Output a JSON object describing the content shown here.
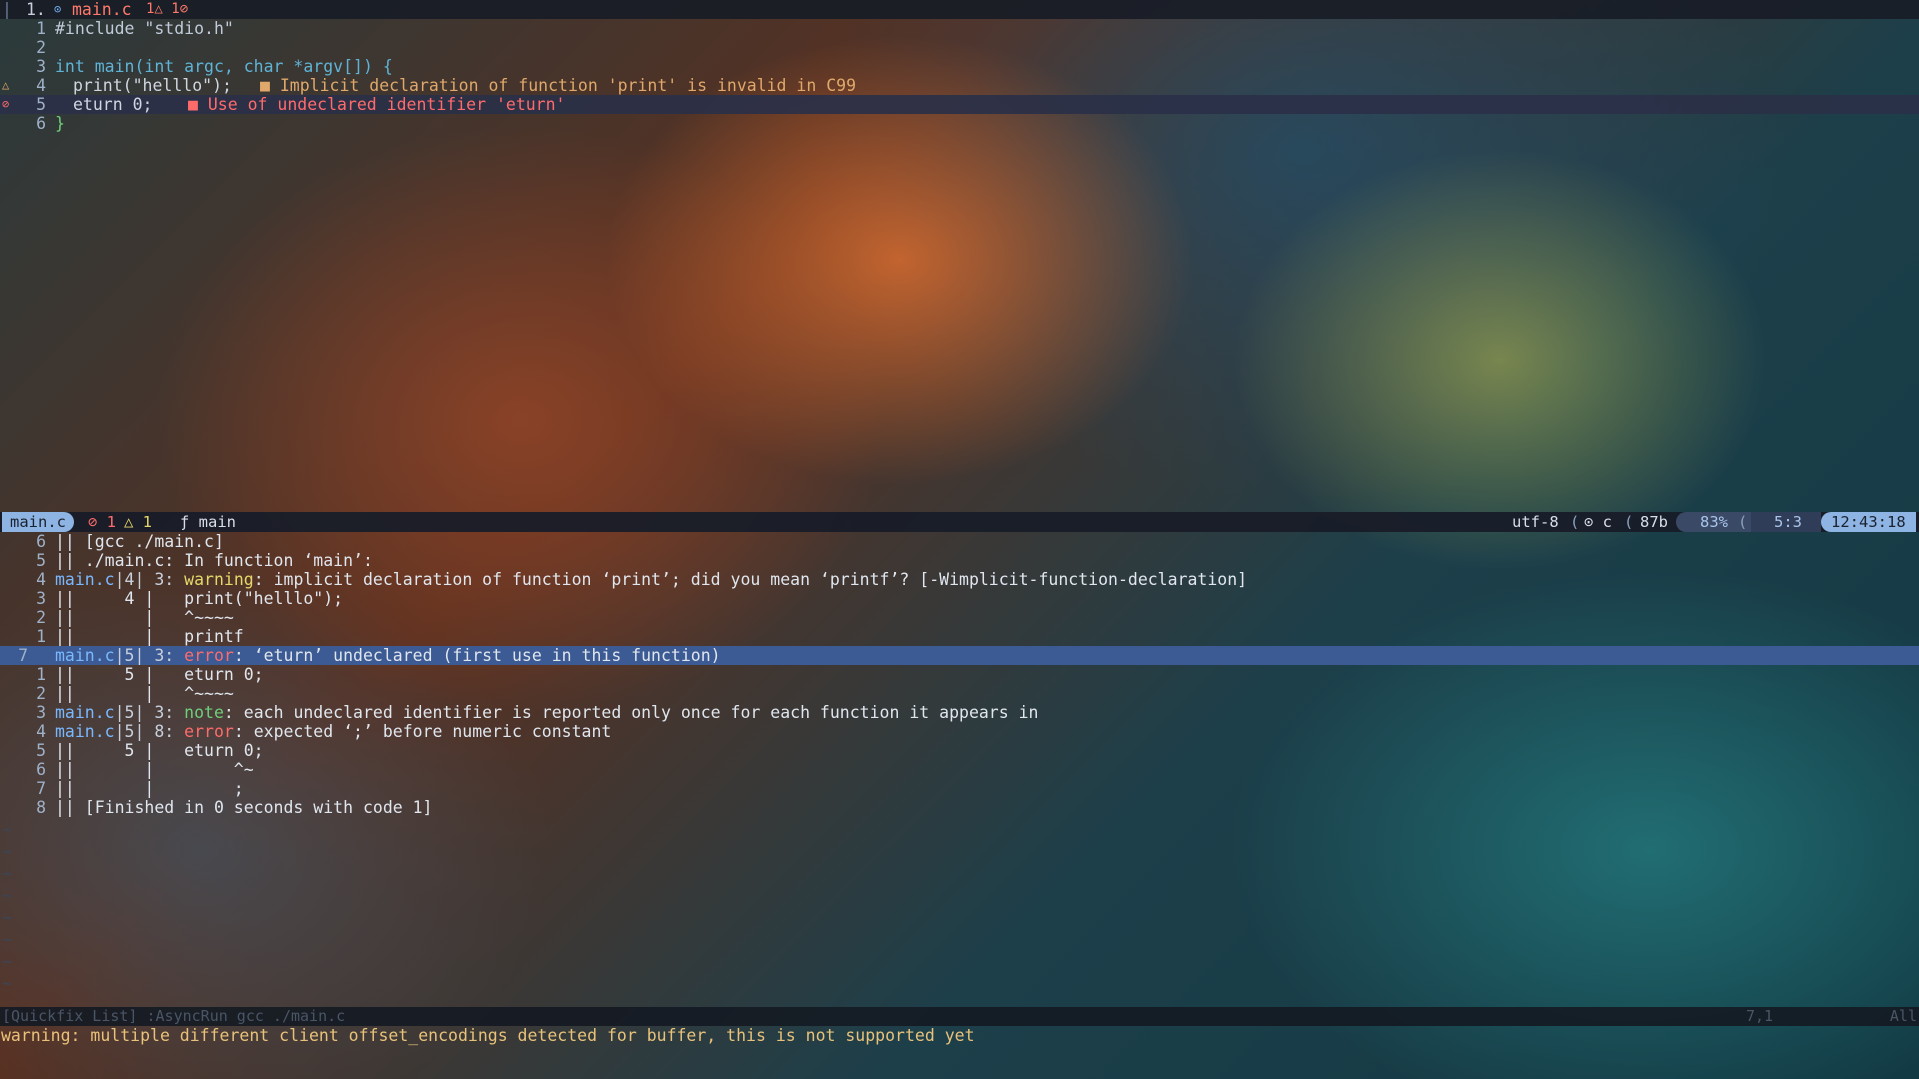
{
  "tabline": {
    "tab_number": "1.",
    "tab_icon": "c-file-icon",
    "tab_file": "main.c",
    "tab_diag": "1△ 1⊘"
  },
  "editor": {
    "lines": [
      {
        "num": "1",
        "text": "#include \"stdio.h\""
      },
      {
        "num": "2",
        "text": ""
      },
      {
        "num": "3",
        "text": "int main(int argc, char *argv[]) {"
      },
      {
        "num": "4",
        "text": "print(\"helllo\");",
        "sign": "△",
        "diag": "■ Implicit declaration of function 'print' is invalid in C99"
      },
      {
        "num": "5",
        "text": "eturn 0;",
        "sign": "⊘",
        "diag": "■ Use of undeclared identifier 'eturn'"
      },
      {
        "num": "6",
        "text": "}"
      }
    ]
  },
  "statusbar": {
    "mode_file": "main.c",
    "errors": "⊘ 1",
    "warnings": "△ 1",
    "func": "ƒ main",
    "encoding": "utf-8",
    "filetype": "⊙ c",
    "size": "87b",
    "percent": "83%",
    "position": "5:3",
    "clock": "12:43:18"
  },
  "quickfix": {
    "lines": [
      {
        "num": "6",
        "text": "|| [gcc ./main.c]"
      },
      {
        "num": "5",
        "text": "|| ./main.c: In function ‘main’:"
      },
      {
        "num": "4",
        "file": "main.c",
        "loc": "|4| 3:",
        "kind": "warning",
        "msg": ": implicit declaration of function ‘print’; did you mean ‘printf’? [-Wimplicit-function-declaration]"
      },
      {
        "num": "3",
        "text": "||     4 |   print(\"helllo\");"
      },
      {
        "num": "2",
        "text": "||       |   ^~~~~"
      },
      {
        "num": "1",
        "text": "||       |   printf"
      },
      {
        "num": "7",
        "file": "main.c",
        "loc": "|5| 3:",
        "kind": "error",
        "msg": ": ‘eturn’ undeclared (first use in this function)"
      },
      {
        "num": "1",
        "text": "||     5 |   eturn 0;"
      },
      {
        "num": "2",
        "text": "||       |   ^~~~~"
      },
      {
        "num": "3",
        "file": "main.c",
        "loc": "|5| 3:",
        "kind": "note",
        "msg": ": each undeclared identifier is reported only once for each function it appears in"
      },
      {
        "num": "4",
        "file": "main.c",
        "loc": "|5| 8:",
        "kind": "error",
        "msg": ": expected ‘;’ before numeric constant"
      },
      {
        "num": "5",
        "text": "||     5 |   eturn 0;"
      },
      {
        "num": "6",
        "text": "||       |        ^~"
      },
      {
        "num": "7",
        "text": "||       |        ;"
      },
      {
        "num": "8",
        "text": "|| [Finished in 0 seconds with code 1]"
      }
    ],
    "status_left": "[Quickfix List] :AsyncRun gcc ./main.c",
    "status_pos": "7,1",
    "status_all": "All"
  },
  "message": "warning: multiple different client offset_encodings detected for buffer, this is not supported yet",
  "colors": {
    "accent": "#5fb3d6",
    "error": "#ff6b6b",
    "warning": "#e0a86a",
    "selection": "#3c5a93"
  }
}
